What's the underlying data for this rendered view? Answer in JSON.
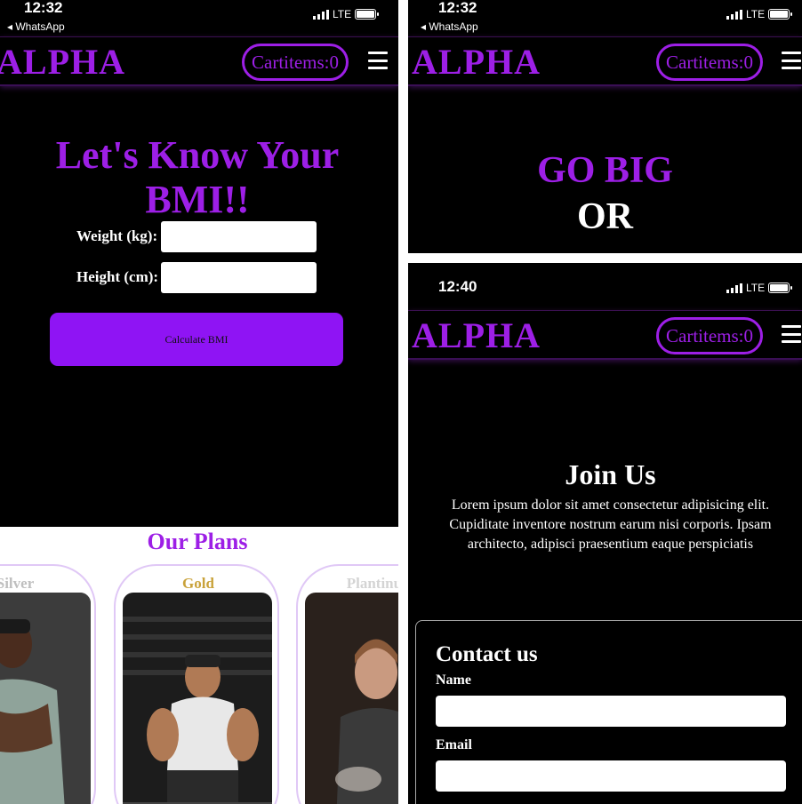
{
  "colors": {
    "accent": "#9d1fe6",
    "button": "#8f14f4",
    "background": "#000000",
    "gold": "#c9a23a",
    "silver": "#bfbfbf",
    "platinum": "#d4d4d4"
  },
  "screens": [
    {
      "status": {
        "time": "12:32",
        "back_label": "◂ WhatsApp",
        "network": "LTE"
      },
      "navbar": {
        "brand": "ALPHA",
        "cart_label": "Cartitems:0",
        "menu_icon": "hamburger-icon"
      },
      "bmi": {
        "title_line1": "Let's Know Your",
        "title_line2": "BMI!!",
        "weight_label": "Weight (kg):",
        "weight_value": "",
        "height_label": "Height (cm):",
        "height_value": "",
        "button_label": "Calculate BMI"
      },
      "plans": {
        "title": "Our Plans",
        "items": [
          {
            "name": "Silver"
          },
          {
            "name": "Gold"
          },
          {
            "name": "Plantinum"
          }
        ]
      }
    },
    {
      "status": {
        "time": "12:32",
        "back_label": "◂ WhatsApp",
        "network": "LTE"
      },
      "navbar": {
        "brand": "ALPHA",
        "cart_label": "Cartitems:0",
        "menu_icon": "hamburger-icon"
      },
      "hero": {
        "line1": "GO BIG",
        "line2": "OR"
      }
    },
    {
      "status": {
        "time": "12:40",
        "network": "LTE"
      },
      "navbar": {
        "brand": "ALPHA",
        "cart_label": "Cartitems:0",
        "menu_icon": "hamburger-icon"
      },
      "join": {
        "title": "Join Us",
        "text": "Lorem ipsum dolor sit amet consectetur adipisicing elit. Cupiditate inventore nostrum earum nisi corporis. Ipsam architecto, adipisci praesentium eaque perspiciatis"
      },
      "contact": {
        "title": "Contact us",
        "name_label": "Name",
        "name_value": "",
        "email_label": "Email",
        "email_value": ""
      }
    }
  ]
}
